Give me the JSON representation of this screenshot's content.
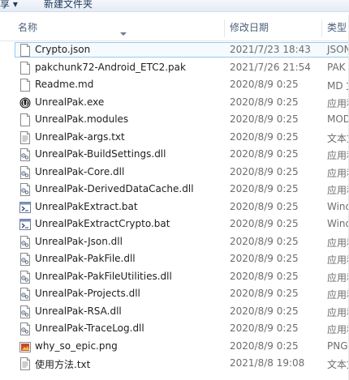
{
  "toolbar": {
    "left_label": "享 ▾",
    "new_folder": "新建文件夹"
  },
  "columns": {
    "name": "名称",
    "date": "修改日期",
    "type": "类型"
  },
  "files": [
    {
      "name": "Crypto.json",
      "date": "2021/7/23 18:43",
      "type": "JSON",
      "icon": "doc-icon"
    },
    {
      "name": "pakchunk72-Android_ETC2.pak",
      "date": "2021/7/26 21:54",
      "type": "PAK",
      "icon": "doc-icon"
    },
    {
      "name": "Readme.md",
      "date": "2020/8/9 0:25",
      "type": "MD 文",
      "icon": "doc-icon"
    },
    {
      "name": "UnrealPak.exe",
      "date": "2020/8/9 0:25",
      "type": "应用程",
      "icon": "unreal-logo-icon"
    },
    {
      "name": "UnrealPak.modules",
      "date": "2020/8/9 0:25",
      "type": "MODU",
      "icon": "doc-icon"
    },
    {
      "name": "UnrealPak-args.txt",
      "date": "2020/8/9 0:25",
      "type": "文本文",
      "icon": "text-doc-icon"
    },
    {
      "name": "UnrealPak-BuildSettings.dll",
      "date": "2020/8/9 0:25",
      "type": "应用程",
      "icon": "dll-icon"
    },
    {
      "name": "UnrealPak-Core.dll",
      "date": "2020/8/9 0:25",
      "type": "应用程",
      "icon": "dll-icon"
    },
    {
      "name": "UnrealPak-DerivedDataCache.dll",
      "date": "2020/8/9 0:25",
      "type": "应用程",
      "icon": "dll-icon"
    },
    {
      "name": "UnrealPakExtract.bat",
      "date": "2020/8/9 0:25",
      "type": "Wind",
      "icon": "bat-icon"
    },
    {
      "name": "UnrealPakExtractCrypto.bat",
      "date": "2020/8/9 0:25",
      "type": "Wind",
      "icon": "bat-icon"
    },
    {
      "name": "UnrealPak-Json.dll",
      "date": "2020/8/9 0:25",
      "type": "应用程",
      "icon": "dll-icon"
    },
    {
      "name": "UnrealPak-PakFile.dll",
      "date": "2020/8/9 0:25",
      "type": "应用程",
      "icon": "dll-icon"
    },
    {
      "name": "UnrealPak-PakFileUtilities.dll",
      "date": "2020/8/9 0:25",
      "type": "应用程",
      "icon": "dll-icon"
    },
    {
      "name": "UnrealPak-Projects.dll",
      "date": "2020/8/9 0:25",
      "type": "应用程",
      "icon": "dll-icon"
    },
    {
      "name": "UnrealPak-RSA.dll",
      "date": "2020/8/9 0:25",
      "type": "应用程",
      "icon": "dll-icon"
    },
    {
      "name": "UnrealPak-TraceLog.dll",
      "date": "2020/8/9 0:25",
      "type": "应用程",
      "icon": "dll-icon"
    },
    {
      "name": "why_so_epic.png",
      "date": "2020/8/9 0:25",
      "type": "PNG",
      "icon": "image-icon"
    },
    {
      "name": "使用方法.txt",
      "date": "2021/8/8 19:08",
      "type": "文本文",
      "icon": "text-doc-icon"
    }
  ],
  "selected_index": 0
}
